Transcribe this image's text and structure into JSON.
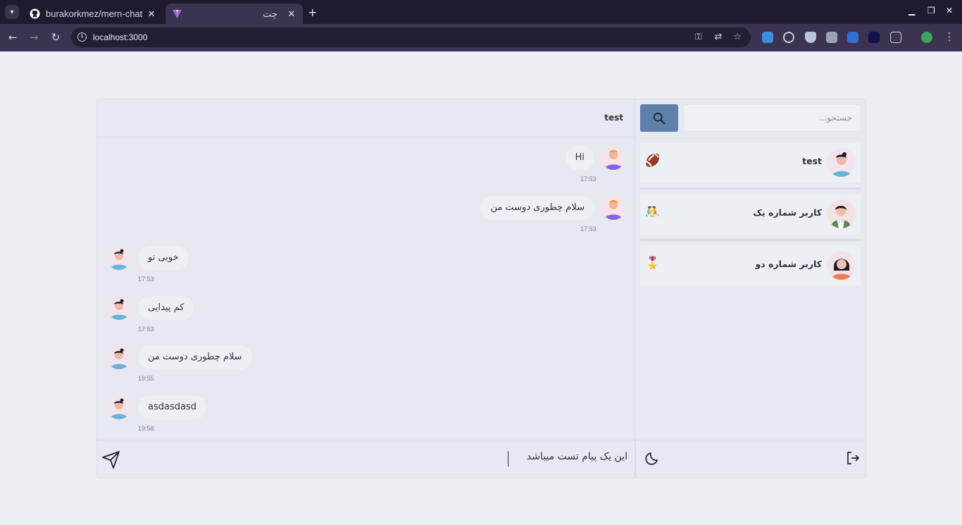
{
  "browser": {
    "tabs": [
      {
        "title": "burakorkmez/mern-chat",
        "active": false
      },
      {
        "title": "چت",
        "active": true
      }
    ],
    "url": "localhost:3000"
  },
  "sidebar": {
    "search_placeholder": "جستجو...",
    "contacts": [
      {
        "name": "test",
        "emoji": "🏈"
      },
      {
        "name": "کاربر شماره یک",
        "emoji": "🤼"
      },
      {
        "name": "کاربر شماره دو",
        "emoji": "🎖️"
      }
    ]
  },
  "chat": {
    "title": "test",
    "messages": [
      {
        "text": "Hi",
        "time": "17:53",
        "from": "me"
      },
      {
        "text": "سلام چطوری دوست من",
        "time": "17:53",
        "from": "me"
      },
      {
        "text": "خوبی تو",
        "time": "17:53",
        "from": "them"
      },
      {
        "text": "کم پیدایی",
        "time": "17:53",
        "from": "them"
      },
      {
        "text": "سلام چطوری دوست من",
        "time": "19:55",
        "from": "them"
      },
      {
        "text": "asdasdasd",
        "time": "19:58",
        "from": "them"
      }
    ],
    "input_value": "این یک پیام تست میباشد"
  },
  "colors": {
    "accent": "#5e81ac",
    "background": "#eceff4",
    "bubble": "#eceff4",
    "text": "#2e3440"
  }
}
